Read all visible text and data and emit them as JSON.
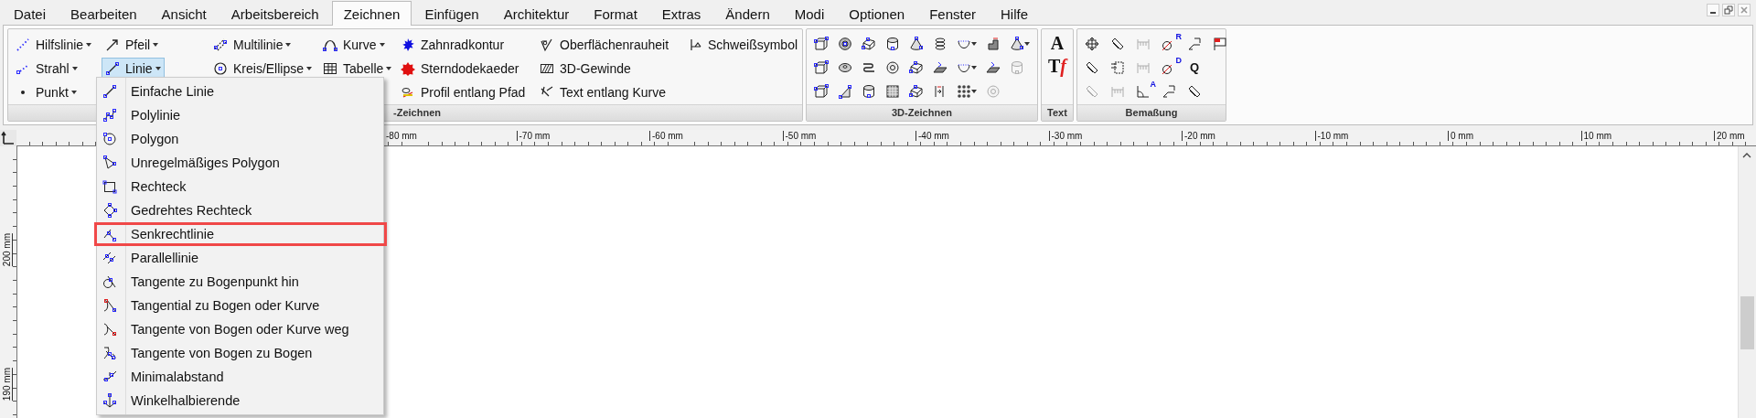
{
  "menu_bar": {
    "tabs": [
      {
        "label": "Datei",
        "selected": false
      },
      {
        "label": "Bearbeiten",
        "selected": false
      },
      {
        "label": "Ansicht",
        "selected": false
      },
      {
        "label": "Arbeitsbereich",
        "selected": false
      },
      {
        "label": "Zeichnen",
        "selected": true
      },
      {
        "label": "Einfügen",
        "selected": false
      },
      {
        "label": "Architektur",
        "selected": false
      },
      {
        "label": "Format",
        "selected": false
      },
      {
        "label": "Extras",
        "selected": false
      },
      {
        "label": "Ändern",
        "selected": false
      },
      {
        "label": "Modi",
        "selected": false
      },
      {
        "label": "Optionen",
        "selected": false
      },
      {
        "label": "Fenster",
        "selected": false
      },
      {
        "label": "Hilfe",
        "selected": false
      }
    ]
  },
  "ribbon": {
    "draw_group": {
      "label": "-Zeichnen",
      "columns": [
        [
          {
            "label": "Hilfslinie",
            "dropdown": true,
            "selected": false
          },
          {
            "label": "Strahl",
            "dropdown": true,
            "selected": false
          },
          {
            "label": "Punkt",
            "dropdown": true,
            "selected": false
          }
        ],
        [
          {
            "label": "Pfeil",
            "dropdown": true,
            "selected": false
          },
          {
            "label": "Linie",
            "dropdown": true,
            "selected": true
          }
        ],
        [
          {
            "label": "Multilinie",
            "dropdown": true,
            "selected": false
          },
          {
            "label": "Kreis/Ellipse",
            "dropdown": true,
            "selected": false
          }
        ],
        [
          {
            "label": "Kurve",
            "dropdown": true,
            "selected": false
          },
          {
            "label": "Tabelle",
            "dropdown": true,
            "selected": false
          }
        ],
        [
          {
            "label": "Zahnradkontur",
            "dropdown": false,
            "selected": false
          },
          {
            "label": "Sterndodekaeder",
            "dropdown": false,
            "selected": false
          },
          {
            "label": "Profil entlang Pfad",
            "dropdown": false,
            "selected": false
          }
        ],
        [
          {
            "label": "Oberflächenrauheit",
            "dropdown": false,
            "selected": false
          },
          {
            "label": "3D-Gewinde",
            "dropdown": false,
            "selected": false
          },
          {
            "label": "Text entlang Kurve",
            "dropdown": false,
            "selected": false
          }
        ],
        [
          {
            "label": "Schweißsymbol",
            "dropdown": false,
            "selected": false
          }
        ]
      ]
    },
    "solid_group": {
      "label": "3D-Zeichnen",
      "rows": [
        [
          {
            "disabled": false,
            "dropdown": false
          },
          {
            "disabled": false,
            "dropdown": false
          },
          {
            "disabled": false,
            "dropdown": false
          },
          {
            "disabled": false,
            "dropdown": false
          },
          {
            "disabled": false,
            "dropdown": false
          },
          {
            "disabled": false,
            "dropdown": false
          },
          {
            "disabled": false,
            "dropdown": true
          },
          {
            "disabled": false,
            "dropdown": false
          },
          {
            "disabled": false,
            "dropdown": true
          }
        ],
        [
          {
            "disabled": false,
            "dropdown": false
          },
          {
            "disabled": false,
            "dropdown": false
          },
          {
            "disabled": false,
            "dropdown": false
          },
          {
            "disabled": false,
            "dropdown": false
          },
          {
            "disabled": false,
            "dropdown": false
          },
          {
            "disabled": false,
            "dropdown": false
          },
          {
            "disabled": false,
            "dropdown": true
          },
          {
            "disabled": false,
            "dropdown": false
          },
          {
            "disabled": true,
            "dropdown": false
          }
        ],
        [
          {
            "disabled": false,
            "dropdown": false
          },
          {
            "disabled": false,
            "dropdown": false
          },
          {
            "disabled": false,
            "dropdown": false
          },
          {
            "disabled": false,
            "dropdown": false
          },
          {
            "disabled": false,
            "dropdown": false
          },
          {
            "disabled": false,
            "dropdown": false
          },
          {
            "disabled": false,
            "dropdown": true
          },
          {
            "disabled": true,
            "dropdown": false
          }
        ]
      ]
    },
    "text_group": {
      "label": "Text",
      "buttons": [
        {
          "glyph": "A"
        },
        {
          "glyph": "T",
          "accent": "f"
        }
      ]
    },
    "dimension_group": {
      "label": "Bemaßung",
      "rows": [
        [
          {
            "disabled": false
          },
          {
            "disabled": false
          },
          {
            "disabled": true
          },
          {
            "disabled": false,
            "glyph": "R"
          },
          {
            "disabled": false
          },
          {
            "disabled": false
          }
        ],
        [
          {
            "disabled": false
          },
          {
            "disabled": false
          },
          {
            "disabled": true
          },
          {
            "disabled": false,
            "glyph": "D"
          },
          {
            "disabled": false,
            "glyph": "Q"
          }
        ],
        [
          {
            "disabled": true
          },
          {
            "disabled": true
          },
          {
            "disabled": false,
            "glyph": "A"
          },
          {
            "disabled": false
          },
          {
            "disabled": false
          }
        ]
      ]
    }
  },
  "dropdown_menu": {
    "items": [
      {
        "label": "Einfache Linie",
        "highlighted": false
      },
      {
        "label": "Polylinie",
        "highlighted": false
      },
      {
        "label": "Polygon",
        "highlighted": false
      },
      {
        "label": "Unregelmäßiges Polygon",
        "highlighted": false
      },
      {
        "label": "Rechteck",
        "highlighted": false
      },
      {
        "label": "Gedrehtes Rechteck",
        "highlighted": false
      },
      {
        "label": "Senkrechtlinie",
        "highlighted": true
      },
      {
        "label": "Parallellinie",
        "highlighted": false
      },
      {
        "label": "Tangente zu Bogenpunkt hin",
        "highlighted": false
      },
      {
        "label": "Tangential zu Bogen oder Kurve",
        "highlighted": false
      },
      {
        "label": "Tangente von Bogen oder Kurve weg",
        "highlighted": false
      },
      {
        "label": "Tangente von Bogen zu Bogen",
        "highlighted": false
      },
      {
        "label": "Minimalabstand",
        "highlighted": false
      },
      {
        "label": "Winkelhalbierende",
        "highlighted": false
      }
    ]
  },
  "rulers": {
    "horizontal": [
      "-80 mm",
      "-70 mm",
      "-60 mm",
      "-50 mm",
      "-40 mm",
      "-30 mm",
      "-20 mm",
      "-10 mm",
      "0 mm",
      "10 mm",
      "20 mm"
    ],
    "vertical": [
      "200 mm",
      "190 mm"
    ]
  }
}
